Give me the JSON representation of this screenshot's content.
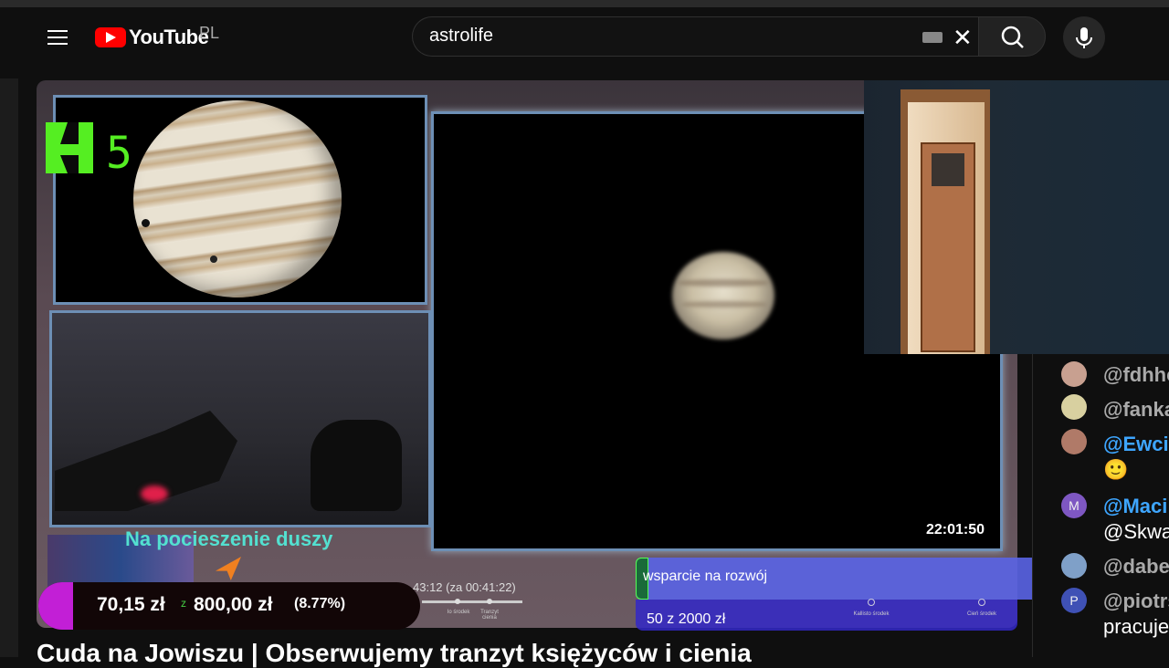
{
  "header": {
    "logo_text": "YouTube",
    "country_code": "PL",
    "search_value": "astrolife"
  },
  "player": {
    "overlay_logo_num": "5",
    "timestamp": "22:01:50",
    "overlay_title": "Na pocieszenie duszy",
    "goal": {
      "current": "70,15 zł",
      "separator": "z",
      "target": "800,00 zł",
      "percent": "(8.77%)"
    },
    "transit_time": "43:12 (za 00:41:22)",
    "timeline_labels": [
      "Io środek",
      "Tranzyt cienia",
      "Kallisto środek",
      "Cień środek"
    ],
    "donation": {
      "title": "wsparcie na rozwój",
      "amount": "50 z 2000 zł",
      "percent": "3%"
    }
  },
  "chat": {
    "messages": [
      {
        "name": "@fdhhc",
        "text": ""
      },
      {
        "name": "@fanka",
        "text": ""
      },
      {
        "name": "@Ewcia",
        "text": "🙂"
      },
      {
        "name": "@Maci",
        "avatar_letter": "M",
        "text": "@Skwa"
      },
      {
        "name": "@dabe",
        "text": ""
      },
      {
        "name": "@piotrs",
        "avatar_letter": "P",
        "text": "pracuje"
      }
    ]
  },
  "video": {
    "title": "Cuda na Jowiszu | Obserwujemy tranzyt księżyców i cienia"
  },
  "colors": {
    "brand_red": "#ff0000",
    "logo_green": "#55ee22",
    "overlay_cyan": "#53e0d0",
    "donation_blue": "#5a64e6",
    "goal_pink": "#c21fd6"
  }
}
